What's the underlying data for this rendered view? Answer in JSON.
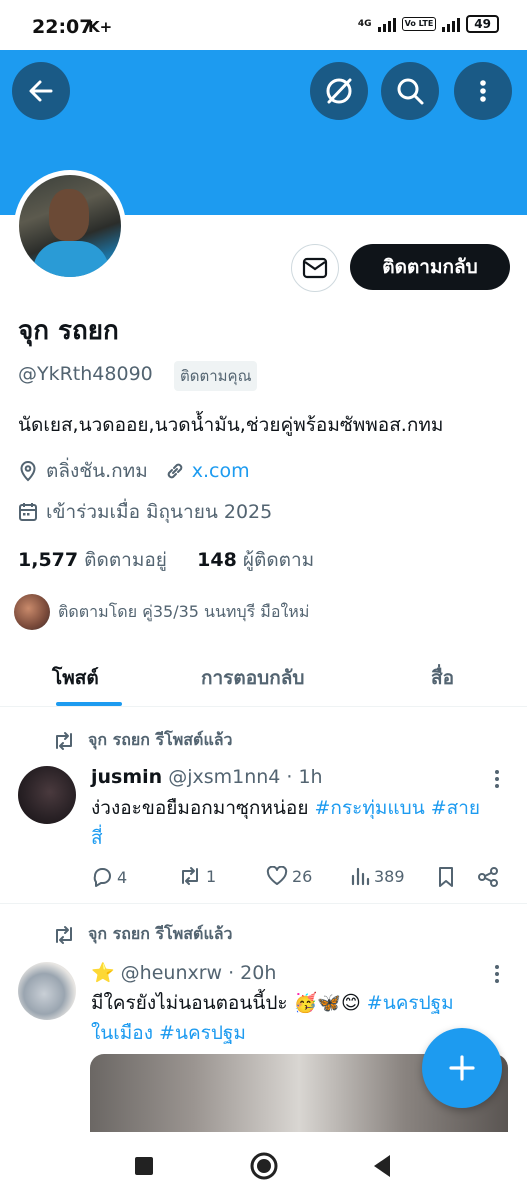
{
  "status_bar": {
    "time": "22:07",
    "carrier_indicator": "K+",
    "network_type": "4G",
    "volte": "Vo LTE",
    "battery": "49"
  },
  "header": {
    "back_icon": "arrow-left-icon",
    "grok_icon": "grok-icon",
    "search_icon": "search-icon",
    "more_icon": "more-vertical-icon"
  },
  "profile": {
    "display_name": "จุก รถยก",
    "handle": "@YkRth48090",
    "follows_you": "ติดตามคุณ",
    "follow_back_label": "ติดตามกลับ",
    "bio": "นัดเยส,นวดออย,นวดน้ำมัน,ช่วยคู่พร้อมซัพพอส.กทม",
    "location": "ตลิ่งชัน.กทม",
    "website": "x.com",
    "joined": "เข้าร่วมเมื่อ มิถุนายน 2025",
    "following_count": "1,577",
    "following_label": "ติดตามอยู่",
    "followers_count": "148",
    "followers_label": "ผู้ติดตาม",
    "followed_by": "ติดตามโดย คู่35/35 นนทบุรี มือใหม่"
  },
  "tabs": [
    {
      "label": "โพสต์",
      "active": true
    },
    {
      "label": "การตอบกลับ",
      "active": false
    },
    {
      "label": "สื่อ",
      "active": false
    }
  ],
  "posts": [
    {
      "repost_label": "จุก รถยก รีโพสต์แล้ว",
      "author_name": "jusmin",
      "author_handle": "@jxsm1nn4",
      "time": "· 1h",
      "text": "ง่วงอะขอยืมอกมาซุกหน่อย",
      "hashtags": [
        "#กระทุ่มแบน",
        "#สายสี่"
      ],
      "replies": "4",
      "reposts": "1",
      "likes": "26",
      "views": "389"
    },
    {
      "repost_label": "จุก รถยก รีโพสต์แล้ว",
      "author_name": "⭐",
      "author_handle": "@heunxrw",
      "time": "· 20h",
      "text": "มีใครยังไม่นอนตอนนี้ปะ 🥳🦋😊",
      "hashtags": [
        "#นครปฐม",
        "ในเมือง",
        "#นครปฐม"
      ]
    }
  ],
  "fab": {
    "icon": "plus-icon"
  },
  "nav": {
    "recents_icon": "square-icon",
    "home_icon": "circle-icon",
    "back_icon": "triangle-back-icon"
  },
  "colors": {
    "accent": "#1d9bf0",
    "dark": "#0f1419",
    "muted": "#536471"
  }
}
